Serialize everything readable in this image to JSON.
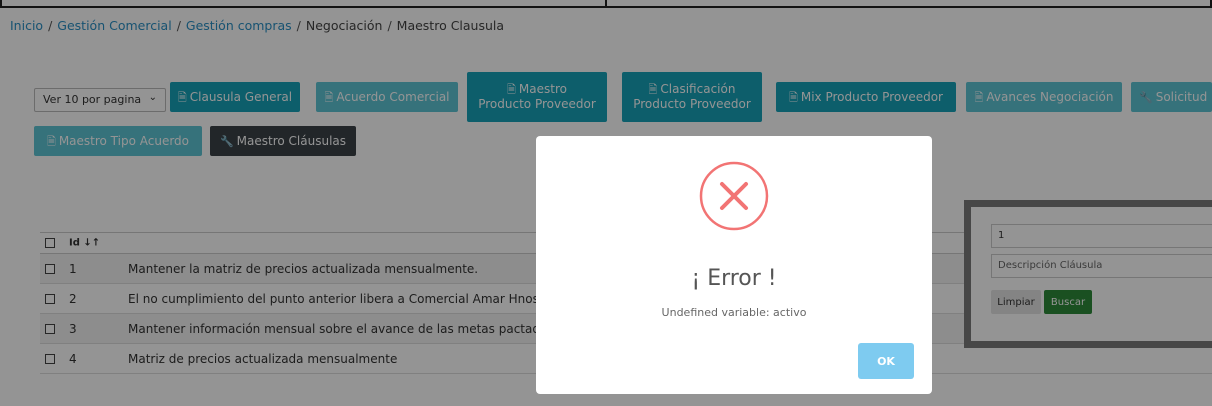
{
  "breadcrumb": {
    "items": [
      "Inicio",
      "Gestión Comercial",
      "Gestión compras",
      "Negociación",
      "Maestro Clausula"
    ],
    "separator": "/"
  },
  "toolbar": {
    "page_size_select": {
      "value": "Ver 10 por pagina",
      "icon": "chevron-down-icon"
    },
    "buttons": [
      {
        "label": "Clausula General",
        "icon": "document-icon"
      },
      {
        "label": "Acuerdo Comercial",
        "icon": "document-icon"
      },
      {
        "label_line1": "Maestro",
        "label_line2": "Producto Proveedor",
        "icon": "document-icon"
      },
      {
        "label_line1": "Clasificación",
        "label_line2": "Producto Proveedor",
        "icon": "document-icon"
      },
      {
        "label": "Mix Producto Proveedor",
        "icon": "document-icon"
      },
      {
        "label": "Avances Negociación",
        "icon": "document-icon"
      },
      {
        "label": "Solicitud",
        "icon": "wrench-icon"
      },
      {
        "label": "Maestro Tipo Acuerdo",
        "icon": "document-icon"
      },
      {
        "label": "Maestro Cláusulas",
        "icon": "wrench-icon"
      }
    ]
  },
  "table": {
    "header": {
      "id": "Id ↓↑"
    },
    "rows": [
      {
        "id": "1",
        "description": "Mantener la matriz de precios actualizada mensualmente."
      },
      {
        "id": "2",
        "description": "El no cumplimiento del punto anterior libera a Comercial Amar Hnos."
      },
      {
        "id": "3",
        "description": "Mantener información mensual sobre el avance de las metas pactadas"
      },
      {
        "id": "4",
        "description": "Matriz de precios actualizada mensualmente"
      }
    ]
  },
  "search_panel": {
    "id_value": "1",
    "description_placeholder": "Descripción Cláusula",
    "clear_label": "Limpiar",
    "search_label": "Buscar"
  },
  "modal": {
    "icon": "error-x-icon",
    "title": "¡ Error !",
    "message": "Undefined variable: activo",
    "ok_label": "OK"
  },
  "colors": {
    "primary": "#17a2b8",
    "dark": "#3c4248",
    "success": "#2e8b3a",
    "error": "#f27474",
    "ok_button": "#7ecbf0",
    "link": "#2a8fc4"
  }
}
